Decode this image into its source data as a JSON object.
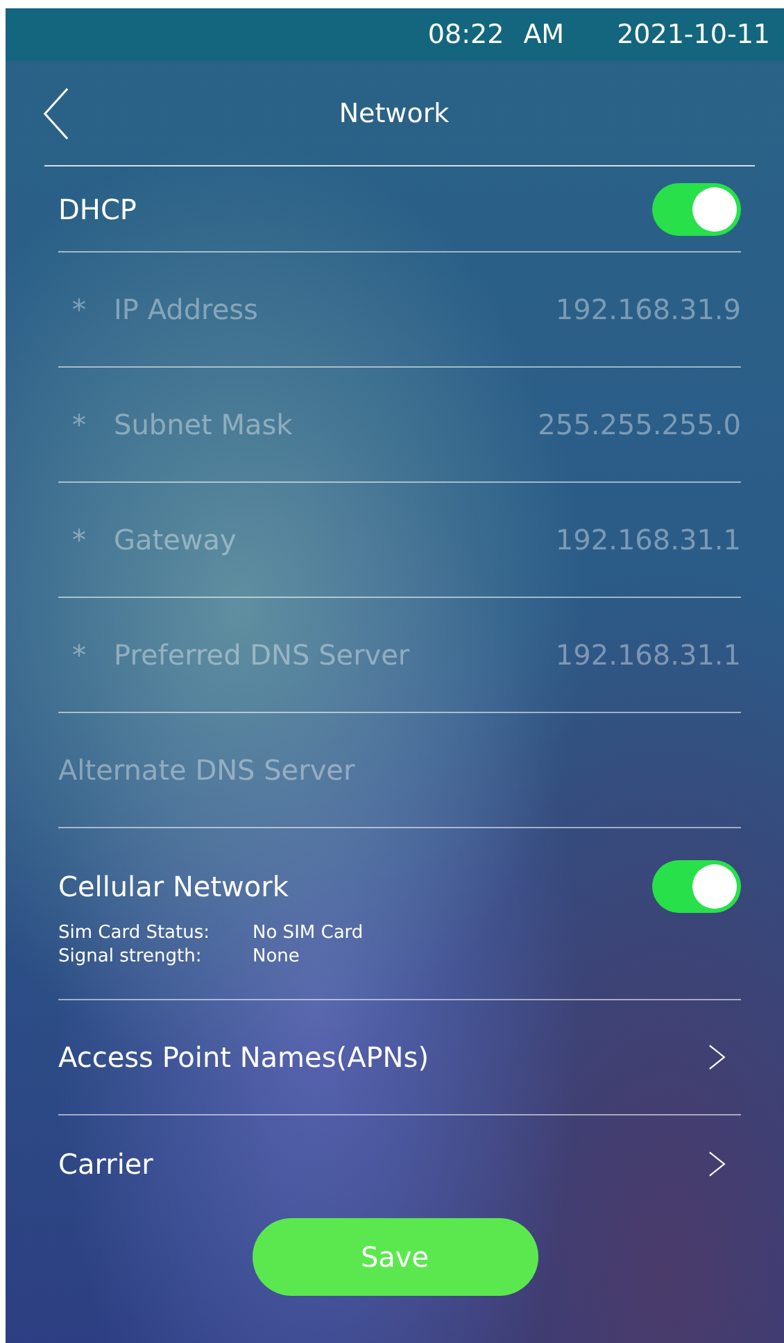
{
  "status_bar": {
    "time": "08:22",
    "meridiem": "AM",
    "date": "2021-10-11"
  },
  "header": {
    "title": "Network"
  },
  "rows": [
    {
      "kind": "toggle",
      "label": "DHCP",
      "on": true
    },
    {
      "kind": "field",
      "mark": "*",
      "label": "IP Address",
      "value": "192.168.31.9",
      "disabled": true
    },
    {
      "kind": "field",
      "mark": "*",
      "label": "Subnet Mask",
      "value": "255.255.255.0",
      "disabled": true
    },
    {
      "kind": "field",
      "mark": "*",
      "label": "Gateway",
      "value": "192.168.31.1",
      "disabled": true
    },
    {
      "kind": "field",
      "mark": "*",
      "label": "Preferred DNS Server",
      "value": "192.168.31.1",
      "disabled": true
    },
    {
      "kind": "field",
      "label": "Alternate DNS Server",
      "disabled": true
    },
    {
      "kind": "toggle",
      "label": "Cellular Network",
      "on": true,
      "details": [
        {
          "label": "Sim Card Status:",
          "value": "No SIM Card"
        },
        {
          "label": "Signal strength:",
          "value": "None"
        }
      ]
    },
    {
      "kind": "link",
      "label": "Access Point Names(APNs)"
    },
    {
      "kind": "link",
      "label": "Carrier"
    }
  ],
  "save_button": {
    "label": "Save"
  }
}
